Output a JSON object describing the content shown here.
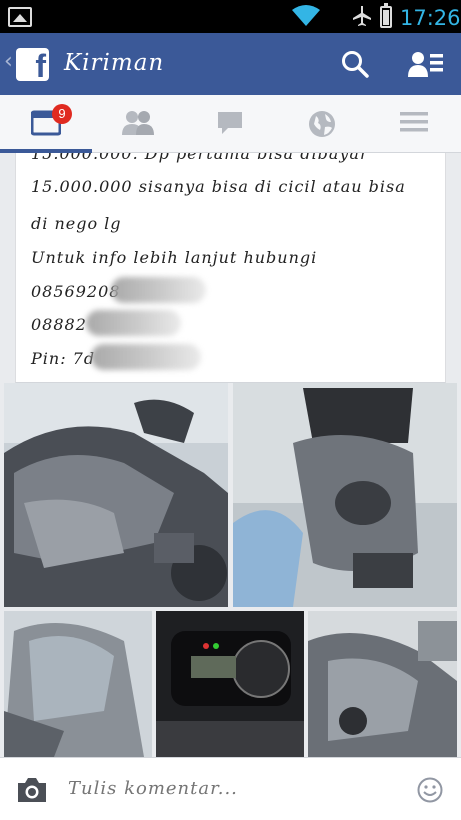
{
  "status_bar": {
    "time": "17:26"
  },
  "header": {
    "back_glyph": "‹",
    "logo_letter": "f",
    "title": "Kiriman"
  },
  "tabs": [
    {
      "name": "news-feed",
      "icon": "news-feed-icon",
      "badge": "9",
      "active": true
    },
    {
      "name": "friend-requests",
      "icon": "friends-icon"
    },
    {
      "name": "messages",
      "icon": "chat-icon"
    },
    {
      "name": "notifications",
      "icon": "globe-icon"
    },
    {
      "name": "more",
      "icon": "menu-icon"
    }
  ],
  "post": {
    "line1_partial": "15.000.000. Dp pertama bisa dibayar",
    "line2": "15.000.000 sisanya bisa di cicil atau bisa",
    "line3": "di nego lg",
    "line4": "Untuk info lebih lanjut hubungi",
    "phone1": "08569208",
    "phone2": "08882",
    "pin": "Pin: 7d"
  },
  "photos": [
    {
      "name": "photo-motorcycle-side"
    },
    {
      "name": "photo-motorcycle-tank"
    },
    {
      "name": "photo-motorcycle-windshield"
    },
    {
      "name": "photo-motorcycle-dashboard"
    },
    {
      "name": "photo-motorcycle-fairing"
    }
  ],
  "comment_bar": {
    "placeholder": "Tulis komentar..."
  },
  "colors": {
    "fb_blue": "#3b5998",
    "status_blue": "#33b5e5",
    "badge_red": "#e02a20"
  }
}
